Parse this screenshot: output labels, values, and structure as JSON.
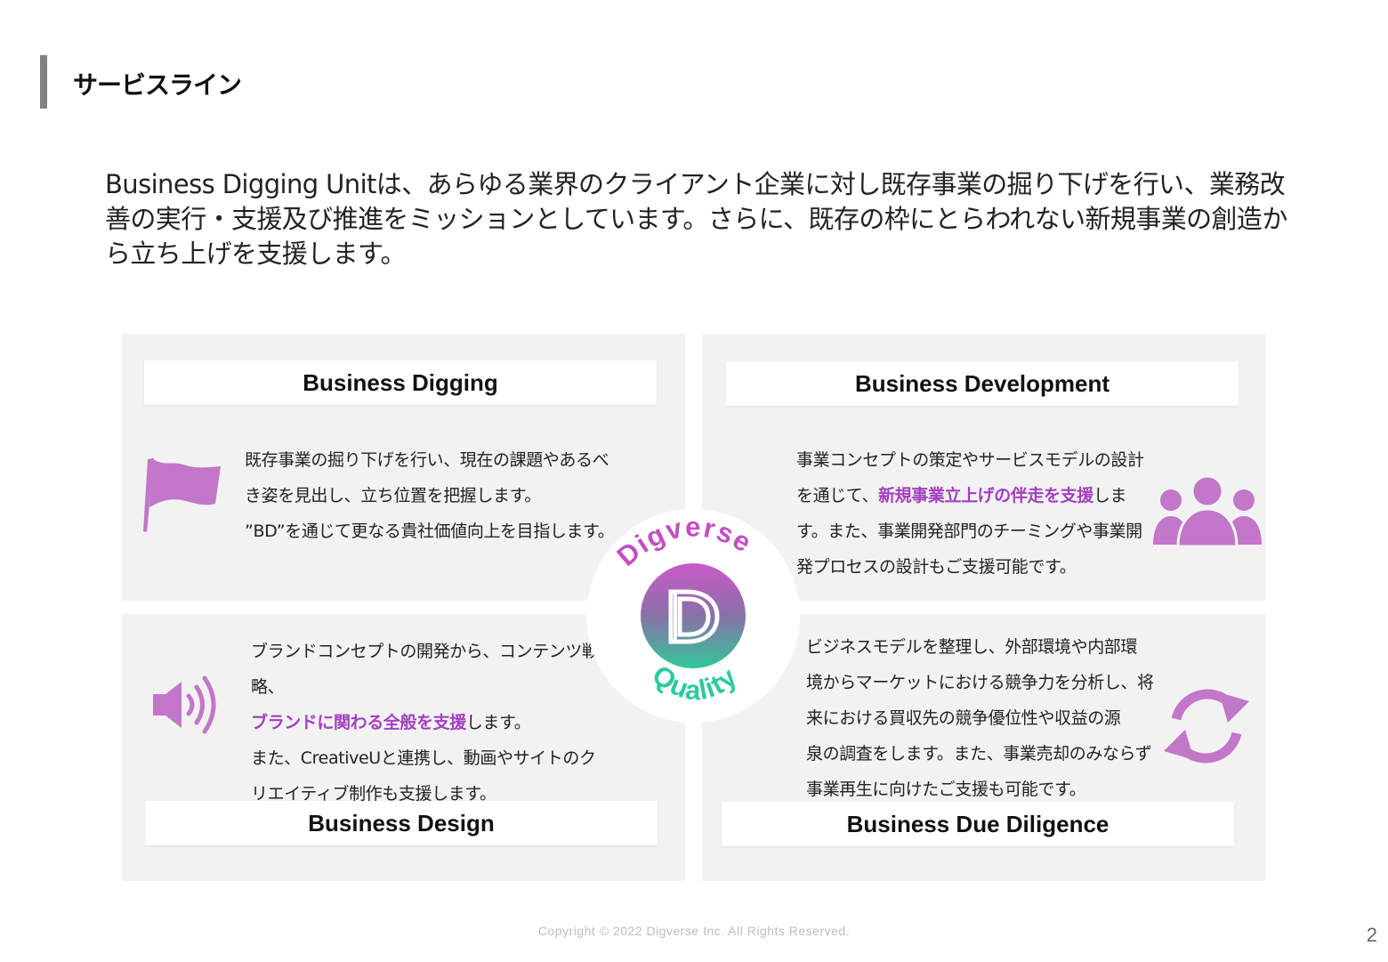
{
  "page": {
    "title": "サービスライン",
    "intro": "Business Digging Unitは、あらゆる業界のクライアント企業に対し既存事業の掘り下げを行い、業務改善の実行・支援及び推進をミッションとしています。さらに、既存の枠にとらわれない新規事業の創造から立ち上げを支援します。",
    "footer": "Copyright © 2022 Digverse Inc.  All Rights  Reserved.",
    "page_number": "2"
  },
  "panels": {
    "digging": {
      "header": "Business Digging",
      "icon": "flag-icon",
      "lines": [
        "既存事業の掘り下げを行い、現在の課題やあるべ",
        "き姿を見出し、立ち位置を把握します。",
        "”BD”を通じて更なる貴社価値向上を目指します。"
      ]
    },
    "development": {
      "header": "Business Development",
      "icon": "people-icon",
      "line1": "事業コンセプトの策定やサービスモデルの設計",
      "line2_pre": "を通じて、",
      "line2_hl": "新規事業立上げの伴走を支援",
      "line2_post": "しま",
      "line3": "す。また、事業開発部門のチーミングや事業開",
      "line4": "発プロセスの設計もご支援可能です。"
    },
    "design": {
      "header": "Business Design",
      "icon": "speaker-icon",
      "line1": "ブランドコンセプトの開発から、コンテンツ戦略、",
      "line2_hl": "ブランドに関わる全般を支援",
      "line2_post": "します。",
      "line3": "また、CreativeUと連携し、動画やサイトのク",
      "line4": "リエイティブ制作も支援します。"
    },
    "due_diligence": {
      "header": "Business Due Diligence",
      "icon": "refresh-cycle-icon",
      "lines": [
        "ビジネスモデルを整理し、外部環境や内部環",
        "境からマーケットにおける競争力を分析し、将",
        "来における買収先の競争優位性や収益の源",
        "泉の調査をします。また、事業売却のみならず",
        "事業再生に向けたご支援も可能です。"
      ]
    }
  },
  "center_logo": {
    "top_text": "Digverse",
    "bottom_text": "Quality",
    "colors": {
      "pink": "#c34fc3",
      "green": "#2ec9a0",
      "accent": "#a33fbf"
    }
  }
}
